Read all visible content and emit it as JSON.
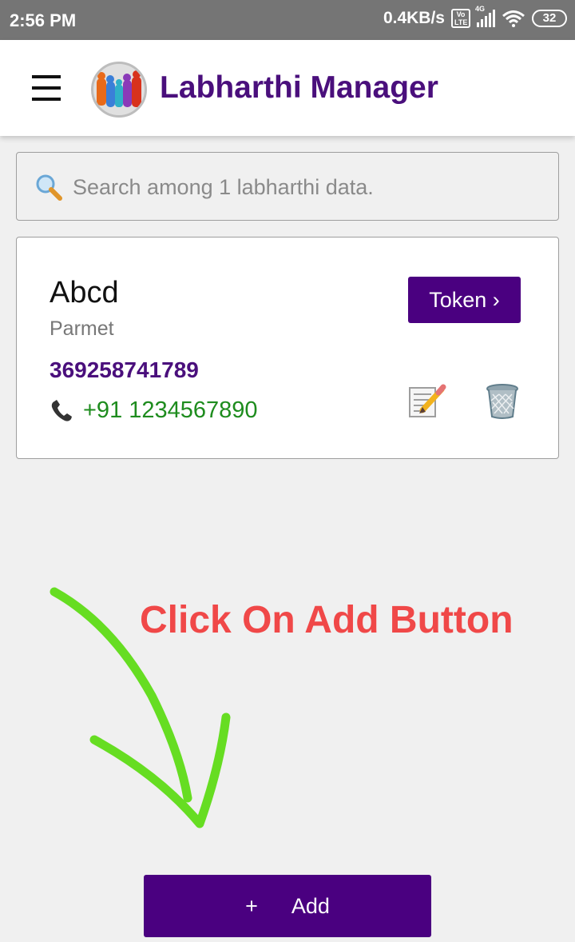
{
  "status_bar": {
    "time": "2:56 PM",
    "speed": "0.4KB/s",
    "volte": "Vo LTE",
    "network": "4G",
    "battery": "32"
  },
  "app_bar": {
    "title": "Labharthi Manager"
  },
  "search": {
    "placeholder": "Search among 1 labharthi data."
  },
  "entries": [
    {
      "name": "Abcd",
      "subtitle": "Parmet",
      "id_number": "369258741789",
      "phone": "+91 1234567890",
      "token_label": "Token ›"
    }
  ],
  "annotation": {
    "text": "Click On Add Button",
    "color": "#f04848",
    "arrow_color": "#66dd22"
  },
  "add_button": {
    "icon": "+",
    "label": "Add"
  },
  "colors": {
    "primary": "#4a0080",
    "title": "#4a0f7c",
    "phone": "#1e8c1e"
  }
}
